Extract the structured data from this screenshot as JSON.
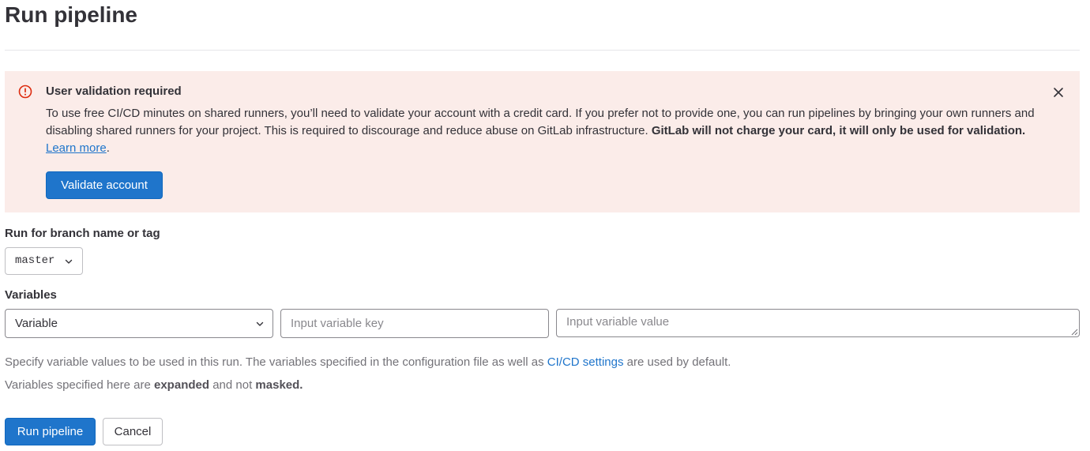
{
  "page": {
    "title": "Run pipeline"
  },
  "alert": {
    "title": "User validation required",
    "body_part1": "To use free CI/CD minutes on shared runners, you’ll need to validate your account with a credit card. If you prefer not to provide one, you can run pipelines by bringing your own runners and disabling shared runners for your project. This is required to discourage and reduce abuse on GitLab infrastructure. ",
    "body_bold": "GitLab will not charge your card, it will only be used for validation.",
    "body_space": " ",
    "learn_more": "Learn more",
    "body_period": ".",
    "validate_button": "Validate account",
    "icon": "error-icon",
    "close_icon": "close-icon",
    "colors": {
      "background": "#fbece9",
      "icon": "#dd2b0e"
    }
  },
  "branch": {
    "label": "Run for branch name or tag",
    "selected": "master"
  },
  "variables": {
    "label": "Variables",
    "type_selected": "Variable",
    "key_placeholder": "Input variable key",
    "value_placeholder": "Input variable value"
  },
  "help": {
    "line1_part1": "Specify variable values to be used in this run. The variables specified in the configuration file as well as ",
    "line1_link": "CI/CD settings",
    "line1_part2": " are used by default.",
    "line2_part1": "Variables specified here are ",
    "line2_bold1": "expanded",
    "line2_part2": " and not ",
    "line2_bold2": "masked."
  },
  "actions": {
    "run_button": "Run pipeline",
    "cancel_button": "Cancel"
  },
  "colors": {
    "primary": "#1f75cb",
    "link": "#1f75cb",
    "text": "#333238",
    "muted": "#737278"
  }
}
